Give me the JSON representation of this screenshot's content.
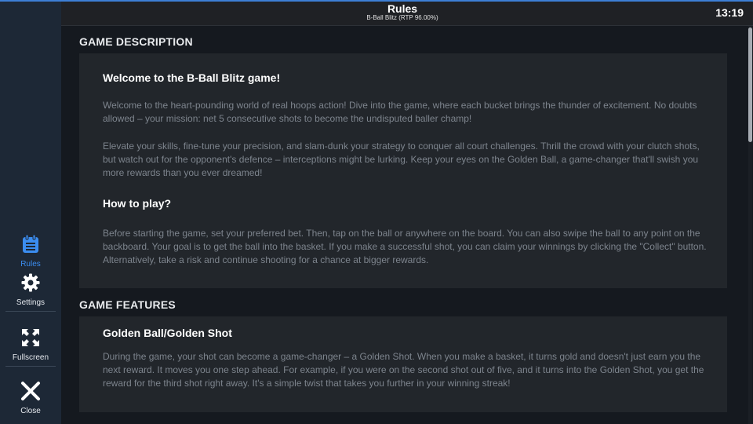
{
  "header": {
    "title": "Rules",
    "subtitle": "B-Ball Blitz (RTP 96.00%)",
    "clock": "13:19"
  },
  "sidebar": {
    "items": [
      {
        "label": "Rules",
        "icon": "rules-icon",
        "active": true
      },
      {
        "label": "Settings",
        "icon": "gear-icon",
        "active": false
      },
      {
        "label": "Fullscreen",
        "icon": "fullscreen-icon",
        "active": false
      },
      {
        "label": "Close",
        "icon": "close-icon",
        "active": false
      }
    ]
  },
  "sections": {
    "description": {
      "title": "GAME DESCRIPTION",
      "heading1": "Welcome to the B-Ball Blitz game!",
      "para1": "Welcome to the heart-pounding world of real hoops action! Dive into the game, where each bucket brings the thunder of excitement. No doubts allowed – your mission: net 5 consecutive shots to become the undisputed baller champ!",
      "para2": "Elevate your skills, fine-tune your precision, and slam-dunk your strategy to conquer all court challenges. Thrill the crowd with your clutch shots, but watch out for the opponent's defence – interceptions might be lurking. Keep your eyes on the Golden Ball, a game-changer that'll swish you more rewards than you ever dreamed!",
      "heading2": "How to play?",
      "para3": "Before starting the game, set your preferred bet. Then, tap on the ball or anywhere on the board. You can also swipe the ball to any point on the backboard. Your goal is to get the ball into the basket. If you make a successful shot, you can claim your winnings by clicking the \"Collect\" button. Alternatively, take a risk and continue shooting for a chance at bigger rewards."
    },
    "features": {
      "title": "GAME FEATURES",
      "heading1": "Golden Ball/Golden Shot",
      "para1": "During the game, your shot can become a game-changer – a Golden Shot. When you make a basket, it turns gold and doesn't just earn you the next reward. It moves you one step ahead. For example, if you were on the second shot out of five, and it turns into the Golden Shot, you get the reward for the third shot right away. It's a simple twist that takes you further in your winning streak!"
    }
  },
  "colors": {
    "accent": "#3b8df0",
    "sidebar_bg": "#1d2836",
    "panel_bg": "#22262b",
    "page_bg": "#15191f"
  }
}
